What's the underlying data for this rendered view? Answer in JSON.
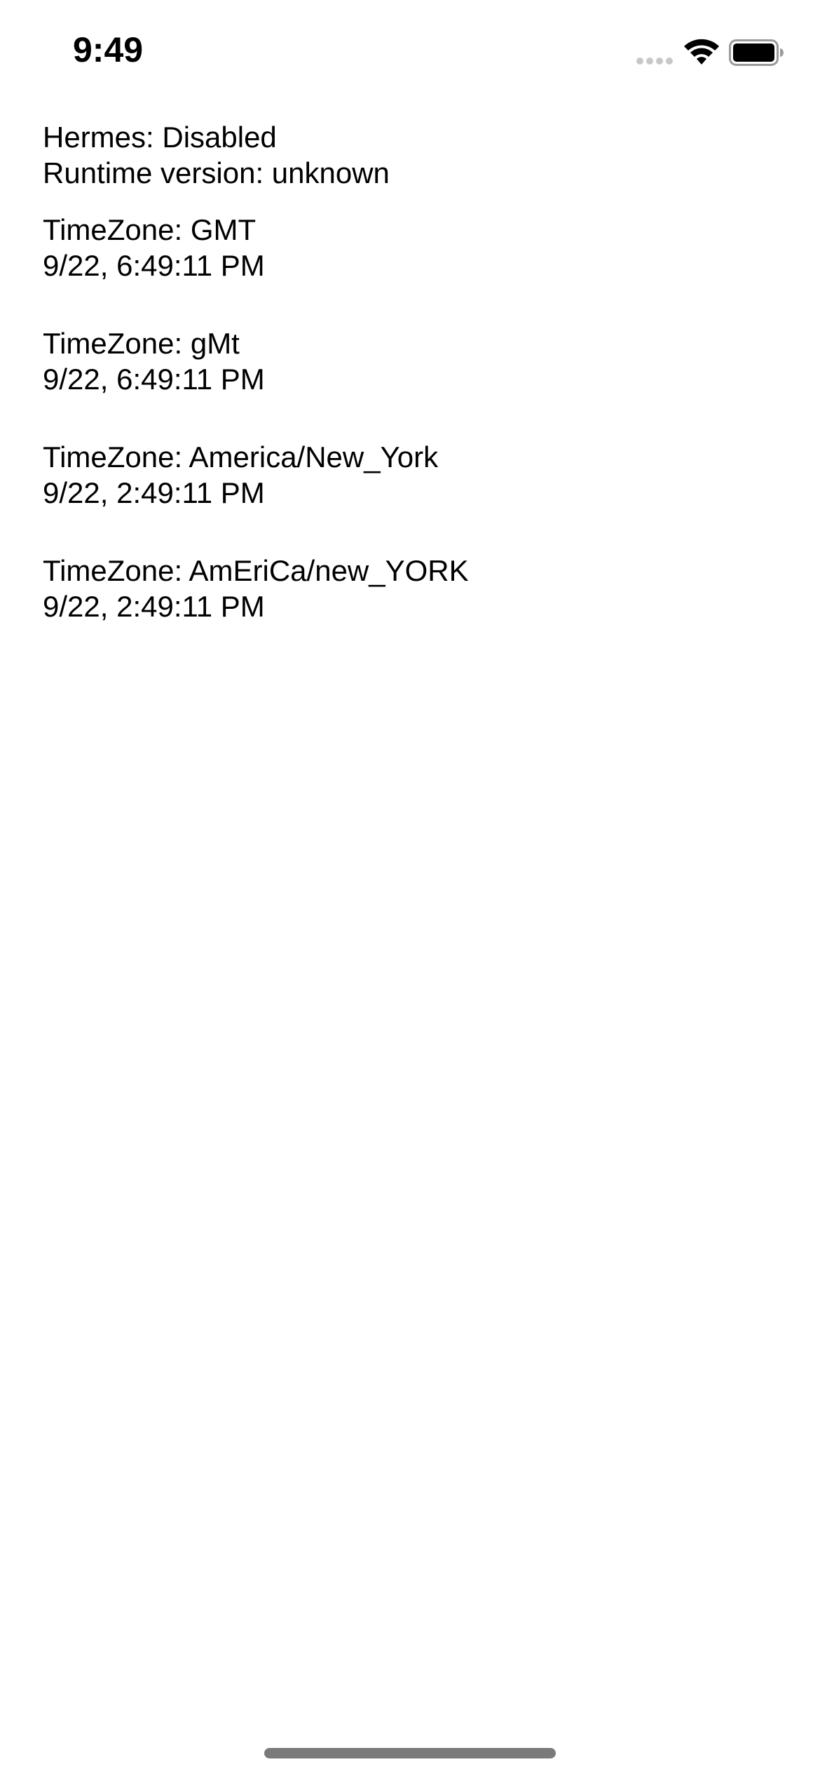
{
  "status_bar": {
    "time": "9:49",
    "icons": [
      "cellular-signal-icon",
      "wifi-icon",
      "battery-icon"
    ]
  },
  "info": {
    "hermes": "Hermes: Disabled",
    "runtime": "Runtime version: unknown"
  },
  "timezones": [
    {
      "label": "TimeZone: GMT",
      "datetime": "9/22, 6:49:11 PM"
    },
    {
      "label": "TimeZone: gMt",
      "datetime": "9/22, 6:49:11 PM"
    },
    {
      "label": "TimeZone: America/New_York",
      "datetime": "9/22, 2:49:11 PM"
    },
    {
      "label": "TimeZone: AmEriCa/new_YORK",
      "datetime": "9/22, 2:49:11 PM"
    }
  ],
  "colors": {
    "background": "#ffffff",
    "text": "#000000",
    "home_indicator": "#7a7a7a"
  }
}
